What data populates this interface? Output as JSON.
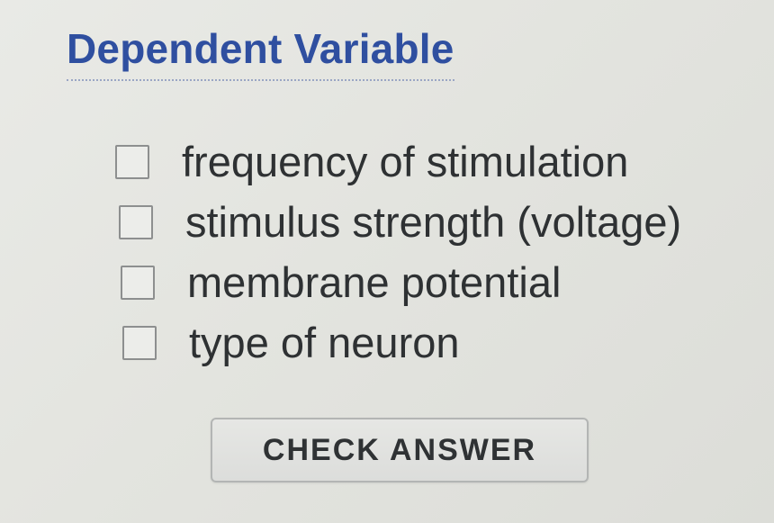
{
  "question": {
    "title": "Dependent Variable"
  },
  "options": [
    {
      "label": "frequency of stimulation",
      "checked": false
    },
    {
      "label": "stimulus strength (voltage)",
      "checked": false
    },
    {
      "label": "membrane potential",
      "checked": false
    },
    {
      "label": "type of neuron",
      "checked": false
    }
  ],
  "actions": {
    "check_answer_label": "CHECK ANSWER"
  },
  "colors": {
    "title": "#2f4fa0",
    "text": "#2e3133",
    "background": "#e3e4df"
  }
}
